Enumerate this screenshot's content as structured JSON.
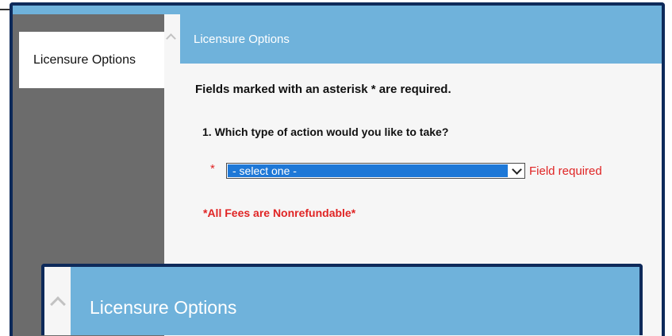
{
  "sidebar": {
    "items": [
      {
        "label": "Licensure Options",
        "selected": true
      }
    ]
  },
  "panel": {
    "title": "Licensure Options"
  },
  "form": {
    "required_note": "Fields marked with an asterisk * are required.",
    "question": "1. Which type of action would you like to take?",
    "asterisk": "*",
    "select_value": "- select one -",
    "error": "Field required",
    "fees_note": "*All Fees are Nonrefundable*"
  },
  "zoom": {
    "title": "Licensure Options"
  },
  "colors": {
    "header_blue": "#6fb2db",
    "frame_navy": "#0e2a5a",
    "select_highlight": "#1e78d7",
    "error_red": "#e02424",
    "sidebar_gray": "#6c6c6c"
  },
  "icons": [
    "chevron-up-icon",
    "chevron-down-icon"
  ]
}
